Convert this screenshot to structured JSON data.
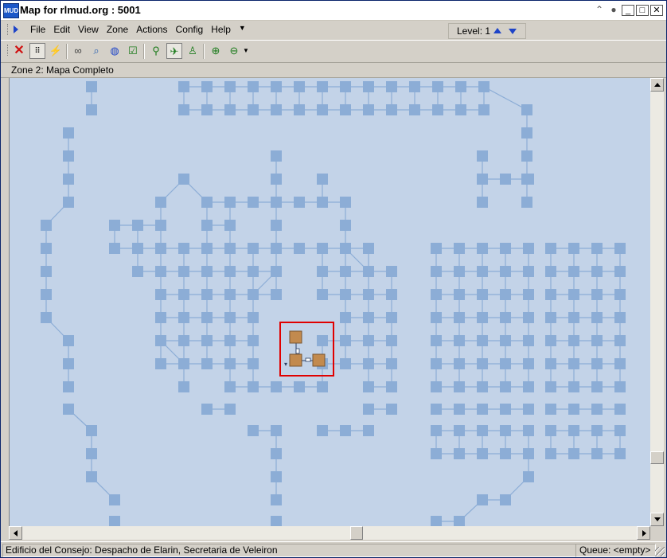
{
  "window": {
    "title": "Map for rlmud.org : 5001",
    "icon_text": "MUD"
  },
  "menubar": {
    "items": [
      "File",
      "Edit",
      "View",
      "Zone",
      "Actions",
      "Config",
      "Help"
    ],
    "level_label": "Level: 1"
  },
  "toolbar": {
    "tools": [
      "close-x-icon",
      "grid-snap-icon",
      "path-tool-icon",
      "binoculars-icon",
      "find-icon",
      "globe-icon",
      "checkbox-icon",
      "walk-tool-icon",
      "speedwalk-icon",
      "runner-icon",
      "zoom-in-icon",
      "zoom-out-icon"
    ]
  },
  "zone": {
    "label": "Zone 2: Mapa Completo"
  },
  "status": {
    "room": "Edificio del Consejo: Despacho de Elarin, Secretaria de Veleiron",
    "queue": "Queue: <empty>"
  },
  "colors": {
    "map_background": "#C3D3E8",
    "room": "#8CADD6",
    "connector": "#8CADD6",
    "current_room": "#C28A4E",
    "highlight": "#E00000"
  }
}
